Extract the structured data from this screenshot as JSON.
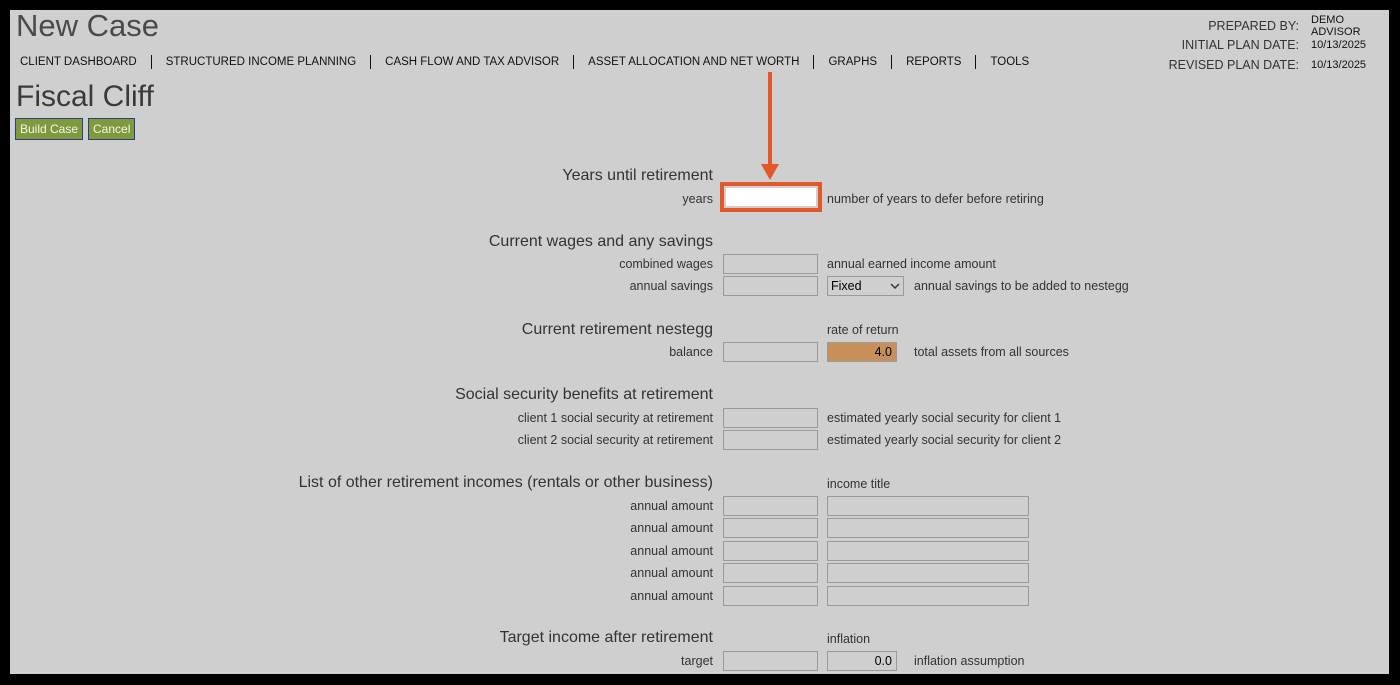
{
  "header": {
    "app_title": "New Case",
    "nav": [
      "CLIENT DASHBOARD",
      "STRUCTURED INCOME PLANNING",
      "CASH FLOW AND TAX ADVISOR",
      "ASSET ALLOCATION AND NET WORTH",
      "GRAPHS",
      "REPORTS",
      "TOOLS"
    ],
    "prepared_by_label": "PREPARED BY:",
    "prepared_by_value": "DEMO ADVISOR",
    "initial_plan_label": "INITIAL PLAN DATE:",
    "initial_plan_value": "10/13/2025",
    "revised_plan_label": "REVISED PLAN DATE:",
    "revised_plan_value": "10/13/2025"
  },
  "case": {
    "title": "Fiscal Cliff",
    "build_label": "Build Case",
    "cancel_label": "Cancel"
  },
  "years_section": {
    "heading": "Years until retirement",
    "years_label": "years",
    "years_value": "",
    "years_desc": "number of years to defer before retiring"
  },
  "wages_section": {
    "heading": "Current wages and any savings",
    "wages_label": "combined wages",
    "wages_desc": "annual earned income amount",
    "savings_label": "annual savings",
    "savings_type": "Fixed",
    "savings_desc": "annual savings to be added to nestegg"
  },
  "nestegg_section": {
    "heading": "Current retirement nestegg",
    "rate_label": "rate of return",
    "balance_label": "balance",
    "rate_value": "4.0",
    "balance_desc": "total assets from all sources"
  },
  "ss_section": {
    "heading": "Social security benefits at retirement",
    "client1_label": "client 1 social security at retirement",
    "client1_desc": "estimated yearly social security for client 1",
    "client2_label": "client 2 social security at retirement",
    "client2_desc": "estimated yearly social security for client 2"
  },
  "other_income_section": {
    "heading": "List of other retirement incomes (rentals or other business)",
    "title_label": "income title",
    "row_label": "annual amount"
  },
  "target_section": {
    "heading": "Target income after retirement",
    "inflation_label": "inflation",
    "target_label": "target",
    "inflation_value": "0.0",
    "inflation_desc": "inflation assumption"
  },
  "colors": {
    "background": "#cfcfcf",
    "button": "#7f9a3a",
    "highlight": "#e2582b",
    "rate_field": "#c98f5b"
  },
  "icons": {
    "annotation": "arrow-down-icon",
    "select": "chevron-down-icon"
  }
}
